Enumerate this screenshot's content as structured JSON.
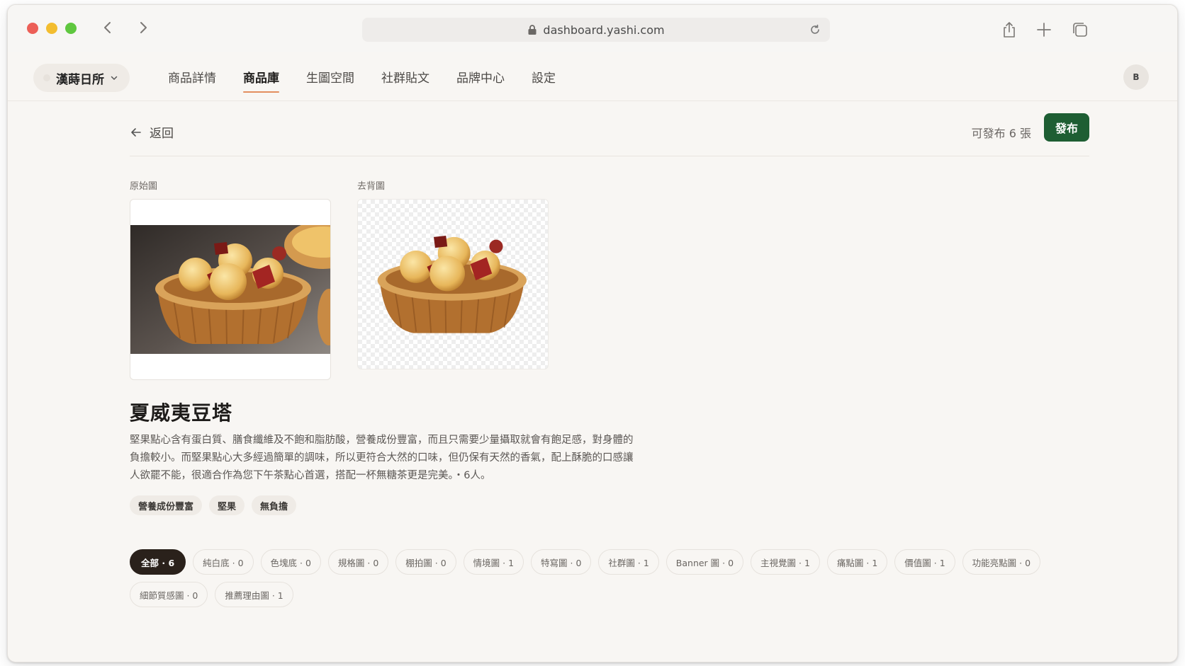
{
  "browser": {
    "url": "dashboard.yashi.com"
  },
  "header": {
    "brand": "漢蒔日所",
    "tabs": [
      {
        "label": "商品詳情",
        "active": false
      },
      {
        "label": "商品庫",
        "active": true
      },
      {
        "label": "生圖空間",
        "active": false
      },
      {
        "label": "社群貼文",
        "active": false
      },
      {
        "label": "品牌中心",
        "active": false
      },
      {
        "label": "設定",
        "active": false
      }
    ],
    "avatar": "B"
  },
  "toolbar": {
    "back_label": "返回",
    "available_text": "可發布 6 張",
    "publish_label": "發布"
  },
  "images": {
    "original_label": "原始圖",
    "removed_bg_label": "去背圖"
  },
  "product": {
    "name": "夏威夷豆塔",
    "description": "堅果點心含有蛋白質、膳食纖維及不飽和脂肪酸，營養成份豐富，而且只需要少量攝取就會有飽足感，對身體的負擔較小。而堅果點心大多經過簡單的調味，所以更符合大然的口味，但仍保有天然的香氣，配上酥脆的口感讓人欲罷不能，很適合作為您下午茶點心首選，搭配一杯無糖茶更是完美。・6人。",
    "tags": [
      "營養成份豐富",
      "堅果",
      "無負擔"
    ]
  },
  "filters": [
    {
      "label": "全部 · 6",
      "active": true
    },
    {
      "label": "純白底 · 0",
      "active": false
    },
    {
      "label": "色塊底 · 0",
      "active": false
    },
    {
      "label": "規格圖 · 0",
      "active": false
    },
    {
      "label": "棚拍圖 · 0",
      "active": false
    },
    {
      "label": "情境圖 · 1",
      "active": false
    },
    {
      "label": "特寫圖 · 0",
      "active": false
    },
    {
      "label": "社群圖 · 1",
      "active": false
    },
    {
      "label": "Banner 圖 · 0",
      "active": false
    },
    {
      "label": "主視覺圖 · 1",
      "active": false
    },
    {
      "label": "痛點圖 · 1",
      "active": false
    },
    {
      "label": "價值圖 · 1",
      "active": false
    },
    {
      "label": "功能亮點圖 · 0",
      "active": false
    },
    {
      "label": "細節質感圖 · 0",
      "active": false
    },
    {
      "label": "推薦理由圖 · 1",
      "active": false
    }
  ],
  "colors": {
    "accent": "#1e5e33",
    "tab_underline": "#e38e5f",
    "active_chip": "#2a211b"
  }
}
